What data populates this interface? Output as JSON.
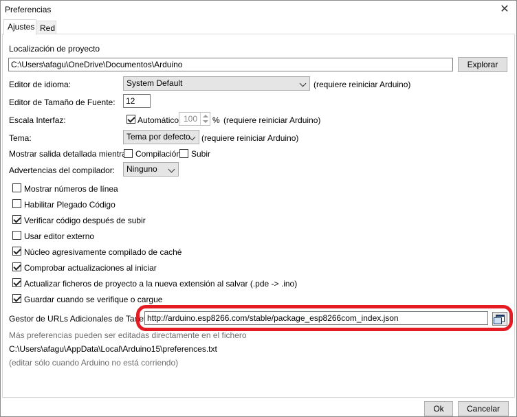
{
  "window": {
    "title": "Preferencias",
    "close_glyph": "✕"
  },
  "tabs": [
    {
      "label": "Ajustes",
      "active": true
    },
    {
      "label": "Red",
      "active": false
    }
  ],
  "sketchbook": {
    "label": "Localización de proyecto",
    "value": "C:\\Users\\afagu\\OneDrive\\Documentos\\Arduino",
    "browse_label": "Explorar"
  },
  "language": {
    "label": "Editor de idioma:",
    "value": "System Default",
    "note": "(requiere reiniciar Arduino)"
  },
  "font_size": {
    "label": "Editor de Tamaño de Fuente:",
    "value": "12"
  },
  "scale": {
    "label": "Escala Interfaz:",
    "auto_label": "Automático",
    "auto_checked": true,
    "value": "100",
    "unit": "%",
    "note": "(requiere reiniciar Arduino)"
  },
  "theme": {
    "label": "Tema:",
    "value": "Tema por defecto",
    "note": "(requiere reiniciar Arduino)"
  },
  "verbose": {
    "label": "Mostrar salida detallada mientras:",
    "compile_label": "Compilación",
    "compile_checked": false,
    "upload_label": "Subir",
    "upload_checked": false
  },
  "warnings": {
    "label": "Advertencias del compilador:",
    "value": "Ninguno"
  },
  "options": [
    {
      "label": "Mostrar números de línea",
      "checked": false
    },
    {
      "label": "Habilitar Plegado Código",
      "checked": false
    },
    {
      "label": "Verificar código después de subir",
      "checked": true
    },
    {
      "label": "Usar editor externo",
      "checked": false
    },
    {
      "label": "Núcleo agresivamente compilado de caché",
      "checked": true
    },
    {
      "label": "Comprobar actualizaciones al iniciar",
      "checked": true
    },
    {
      "label": "Actualizar ficheros de proyecto a la nueva extensión al salvar (.pde -> .ino)",
      "checked": true
    },
    {
      "label": "Guardar cuando se verifique o cargue",
      "checked": true
    }
  ],
  "board_urls": {
    "label": "Gestor de URLs Adicionales de Tarjetas:",
    "value": "http://arduino.esp8266.com/stable/package_esp8266com_index.json",
    "button_icon": "window-list-icon",
    "highlight_color": "#e41b23"
  },
  "more_prefs": {
    "note": "Más preferencias pueden ser editadas directamente en el fichero",
    "path": "C:\\Users\\afagu\\AppData\\Local\\Arduino15\\preferences.txt",
    "edit_note": "(editar sólo cuando Arduino no está corriendo)"
  },
  "footer": {
    "ok_label": "Ok",
    "cancel_label": "Cancelar"
  }
}
